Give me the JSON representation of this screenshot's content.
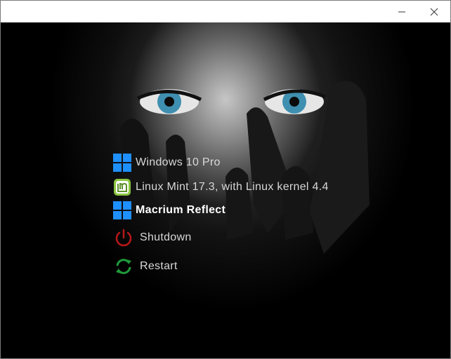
{
  "window": {
    "controls": {
      "minimize_icon": "minimize-icon",
      "close_icon": "close-icon"
    }
  },
  "boot_menu": {
    "selected_index": 2,
    "entries": [
      {
        "label": "Windows 10 Pro",
        "icon": "windows-logo-icon"
      },
      {
        "label": "Linux Mint 17.3, with Linux kernel 4.4",
        "icon": "linux-mint-logo-icon"
      },
      {
        "label": "Macrium Reflect",
        "icon": "windows-logo-icon"
      },
      {
        "label": "Shutdown",
        "icon": "power-icon"
      },
      {
        "label": "Restart",
        "icon": "restart-icon"
      }
    ]
  },
  "colors": {
    "windows_blue": "#1e90ff",
    "mint_green": "#8bc53f",
    "shutdown_red": "#b81818",
    "restart_green": "#1f9a3a",
    "background": "#000000",
    "label_text": "#d8d8d8",
    "selected_text": "#ffffff"
  }
}
